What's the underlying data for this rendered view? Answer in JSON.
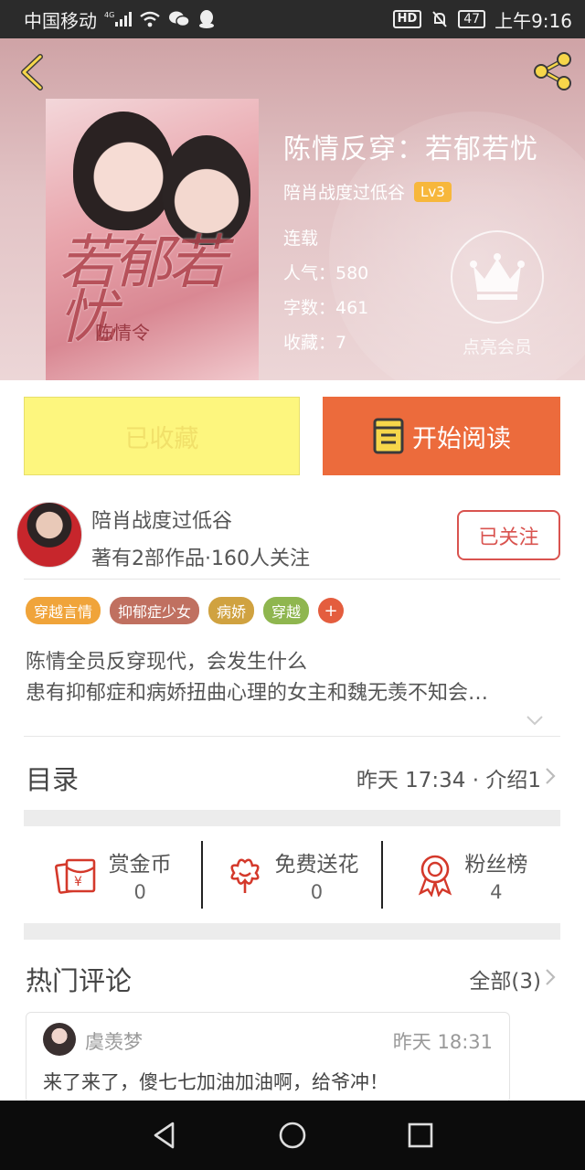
{
  "status_bar": {
    "carrier": "中国移动",
    "network": "4G",
    "hd_label": "HD",
    "battery": "47",
    "time": "上午9:16"
  },
  "book": {
    "title": "陈情反穿：若郁若忧",
    "author": "陪肖战度过低谷",
    "level": "Lv3",
    "status": "连载",
    "popularity": "人气：580",
    "word_count": "字数：461",
    "favorites": "收藏：7",
    "cover_art_title": "若郁若忧",
    "cover_art_sub": "陈情令"
  },
  "vip": {
    "label": "点亮会员"
  },
  "actions": {
    "favorited_label": "已收藏",
    "read_label": "开始阅读"
  },
  "author_card": {
    "name": "陪肖战度过低谷",
    "stats": "著有2部作品·160人关注",
    "follow_label": "已关注"
  },
  "tags": [
    {
      "label": "穿越言情",
      "color": "#f0a43a"
    },
    {
      "label": "抑郁症少女",
      "color": "#c07060"
    },
    {
      "label": "病娇",
      "color": "#d0a240"
    },
    {
      "label": "穿越",
      "color": "#8fb64f"
    }
  ],
  "tag_more": "+",
  "description": {
    "line1": "陈情全员反穿现代，会发生什么",
    "line2": "患有抑郁症和病娇扭曲心理的女主和魏无羡不知会…"
  },
  "toc": {
    "title": "目录",
    "info": "昨天 17:34 · 介绍1"
  },
  "stats": [
    {
      "name": "赏金币",
      "value": "0",
      "icon": "red-envelope-icon"
    },
    {
      "name": "免费送花",
      "value": "0",
      "icon": "flower-icon"
    },
    {
      "name": "粉丝榜",
      "value": "4",
      "icon": "medal-icon"
    }
  ],
  "hot_comments": {
    "title": "热门评论",
    "all_label": "全部(3)",
    "items": [
      {
        "user": "虞羡梦",
        "time": "昨天 18:31",
        "text": "来了来了，傻七七加油加油啊，给爷冲！"
      }
    ]
  },
  "colors": {
    "accent": "#ec6b3c",
    "follow": "#d9534f",
    "favorited_bg": "#fdf67e",
    "icon_red": "#d4392b"
  }
}
